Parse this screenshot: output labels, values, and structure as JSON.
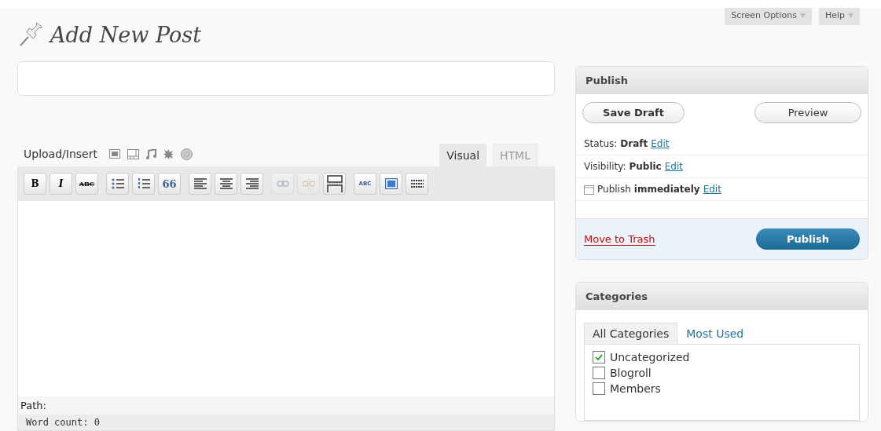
{
  "header": {
    "title": "Add New Post",
    "buttons": [
      {
        "label": "Screen Options"
      },
      {
        "label": "Help"
      }
    ]
  },
  "upload": {
    "label": "Upload/Insert",
    "media": [
      {
        "kind": "image"
      },
      {
        "kind": "video"
      },
      {
        "kind": "audio"
      },
      {
        "kind": "media"
      },
      {
        "kind": "circle"
      }
    ]
  },
  "editor_tabs": [
    {
      "label": "Visual",
      "selected": true
    },
    {
      "label": "HTML",
      "selected": false
    }
  ],
  "toolbar": [
    {
      "kind": "bold",
      "label": "B",
      "disabled": false
    },
    {
      "kind": "italic",
      "label": "I",
      "disabled": false
    },
    {
      "kind": "strike",
      "label": "ABC",
      "disabled": false
    },
    {
      "kind": "bullets",
      "disabled": false
    },
    {
      "kind": "numbers",
      "disabled": false
    },
    {
      "kind": "quote",
      "label": "66",
      "disabled": false
    },
    {
      "kind": "align-left",
      "disabled": false
    },
    {
      "kind": "align-center",
      "disabled": false
    },
    {
      "kind": "align-right",
      "disabled": false
    },
    {
      "kind": "link",
      "disabled": true
    },
    {
      "kind": "unlink",
      "disabled": true
    },
    {
      "kind": "more",
      "disabled": false
    },
    {
      "kind": "spell",
      "label": "ABC",
      "disabled": false
    },
    {
      "kind": "fullscreen",
      "disabled": false
    },
    {
      "kind": "kitchen",
      "disabled": false
    }
  ],
  "editor": {
    "path": "Path:",
    "word_count": "Word count: 0"
  },
  "publish": {
    "title": "Publish",
    "save_draft": "Save Draft",
    "preview": "Preview",
    "rows": [
      {
        "kind": "status",
        "label": "Status:",
        "value": "Draft",
        "link": "Edit"
      },
      {
        "kind": "visibility",
        "label": "Visibility:",
        "value": "Public",
        "link": "Edit"
      },
      {
        "kind": "schedule",
        "label": "Publish",
        "value": "immediately",
        "link": "Edit"
      }
    ],
    "trash": "Move to Trash",
    "publish_button": "Publish"
  },
  "categories": {
    "title": "Categories",
    "tabs": [
      {
        "label": "All Categories",
        "selected": true
      },
      {
        "label": "Most Used",
        "selected": false
      }
    ],
    "items": [
      {
        "label": "Uncategorized",
        "checked": true
      },
      {
        "label": "Blogroll",
        "checked": false
      },
      {
        "label": "Members",
        "checked": false
      }
    ]
  }
}
